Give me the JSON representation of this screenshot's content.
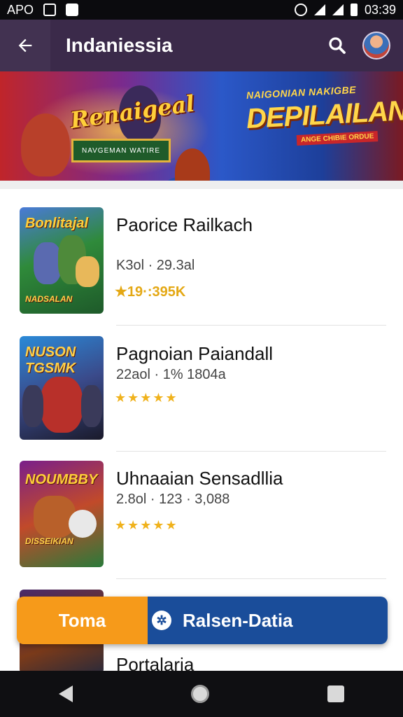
{
  "status_bar": {
    "left_text": "APO",
    "time": "03:39"
  },
  "app_bar": {
    "title": "Indaniessia",
    "back_icon": "arrow-left-icon",
    "search_icon": "search-icon",
    "avatar_icon": "avatar"
  },
  "banner": {
    "left_logo": "Renaigeal",
    "left_plate": "NAVGEMAN WATIRE",
    "right_small": "NAIGONIAN NAKIGBE",
    "right_logo": "DEPILAILAN",
    "right_sub": "ANGE CHIBIE ORDUE"
  },
  "items": [
    {
      "thumb_title": "Bonlitajal",
      "thumb_sub": "NADSALAN",
      "name": "Paorice Railkach",
      "meta": "K3ol · 29.3al",
      "rating": "★19·:395K",
      "thumb_colors": [
        "#1e6a3a",
        "#5aa83a",
        "#f0b040"
      ]
    },
    {
      "thumb_title": "NUSON TGSMK",
      "name": "Pagnoian Paiandall",
      "meta": "22aol · 1% 1804a",
      "stars": "★★★★★",
      "thumb_colors": [
        "#1a5aa8",
        "#c0352a",
        "#223"
      ]
    },
    {
      "thumb_title": "NOUMBBY",
      "thumb_sub": "DISSEIKIAN",
      "name": "Uhnaaian Sensadllia",
      "meta": "2.8ol · 123 · 3,088",
      "stars": "★★★★★",
      "thumb_colors": [
        "#8a1f8a",
        "#d14a2a",
        "#2a7a3a"
      ]
    },
    {
      "name": "Portalaria",
      "thumb_colors": [
        "#7a3a1a",
        "#4a2a6a",
        "#2a2a3a"
      ]
    }
  ],
  "action_bar": {
    "primary_label": "Toma",
    "secondary_label": "Ralsen-Datia",
    "secondary_icon": "settings-icon"
  },
  "nav": {
    "back": "back-icon",
    "home": "home-icon",
    "recent": "recents-icon"
  }
}
